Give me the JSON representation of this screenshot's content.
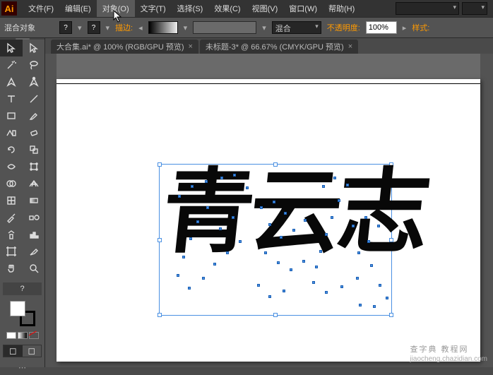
{
  "menu": {
    "file": "文件(F)",
    "edit": "编辑(E)",
    "object": "对象(O)",
    "type": "文字(T)",
    "select": "选择(S)",
    "effect": "效果(C)",
    "view": "视图(V)",
    "window": "窗口(W)",
    "help": "帮助(H)"
  },
  "optbar": {
    "blend_label": "混合对象",
    "stroke_label": "描边:",
    "blend_dd": "混合",
    "opacity_label": "不透明度:",
    "opacity_value": "100%",
    "style_label": "样式:"
  },
  "tabs": [
    {
      "label": "大合集.ai* @ 100% (RGB/GPU 预览)"
    },
    {
      "label": "未标题-3* @ 66.67% (CMYK/GPU 预览)"
    }
  ],
  "tools": {
    "help": "?",
    "footer_dots": "⋯"
  },
  "calligraphy": "青云志",
  "watermark": {
    "main": "查字典 教程网",
    "sub": "jiaocheng.chazidian.com"
  }
}
